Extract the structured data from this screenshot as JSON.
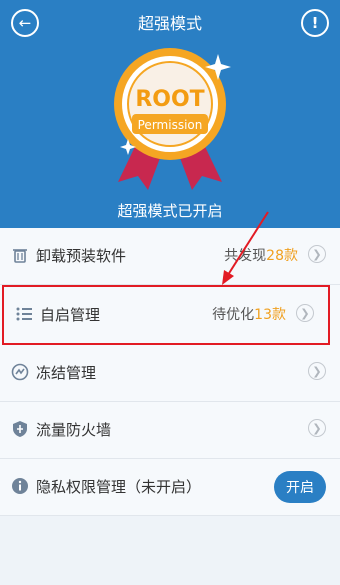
{
  "header": {
    "title": "超强模式",
    "back_icon": "back-arrow-icon",
    "info_icon": "info-icon",
    "info_glyph": "!",
    "status_text": "超强模式已开启",
    "background_color": "#2a7fc4"
  },
  "badge": {
    "line1": "ROOT",
    "line2": "Permission",
    "ribbon_color": "#c8284f",
    "medal_color": "#f5a623"
  },
  "list": {
    "items": [
      {
        "label": "卸载预装软件",
        "value_prefix": "共发现",
        "value_count": "28款",
        "icon": "trash-icon"
      },
      {
        "label": "自启管理",
        "value_prefix": "待优化",
        "value_count": "13款",
        "icon": "list-icon"
      },
      {
        "label": "冻结管理",
        "value_prefix": "",
        "value_count": "",
        "icon": "freeze-icon"
      },
      {
        "label": "流量防火墙",
        "value_prefix": "",
        "value_count": "",
        "icon": "shield-icon"
      },
      {
        "label": "隐私权限管理（未开启）",
        "value_prefix": "",
        "value_count": "",
        "icon": "info-icon",
        "button": "开启"
      }
    ]
  },
  "colors": {
    "accent": "#2a7fc4",
    "count": "#f0a020",
    "highlight_border": "#e21b24"
  }
}
